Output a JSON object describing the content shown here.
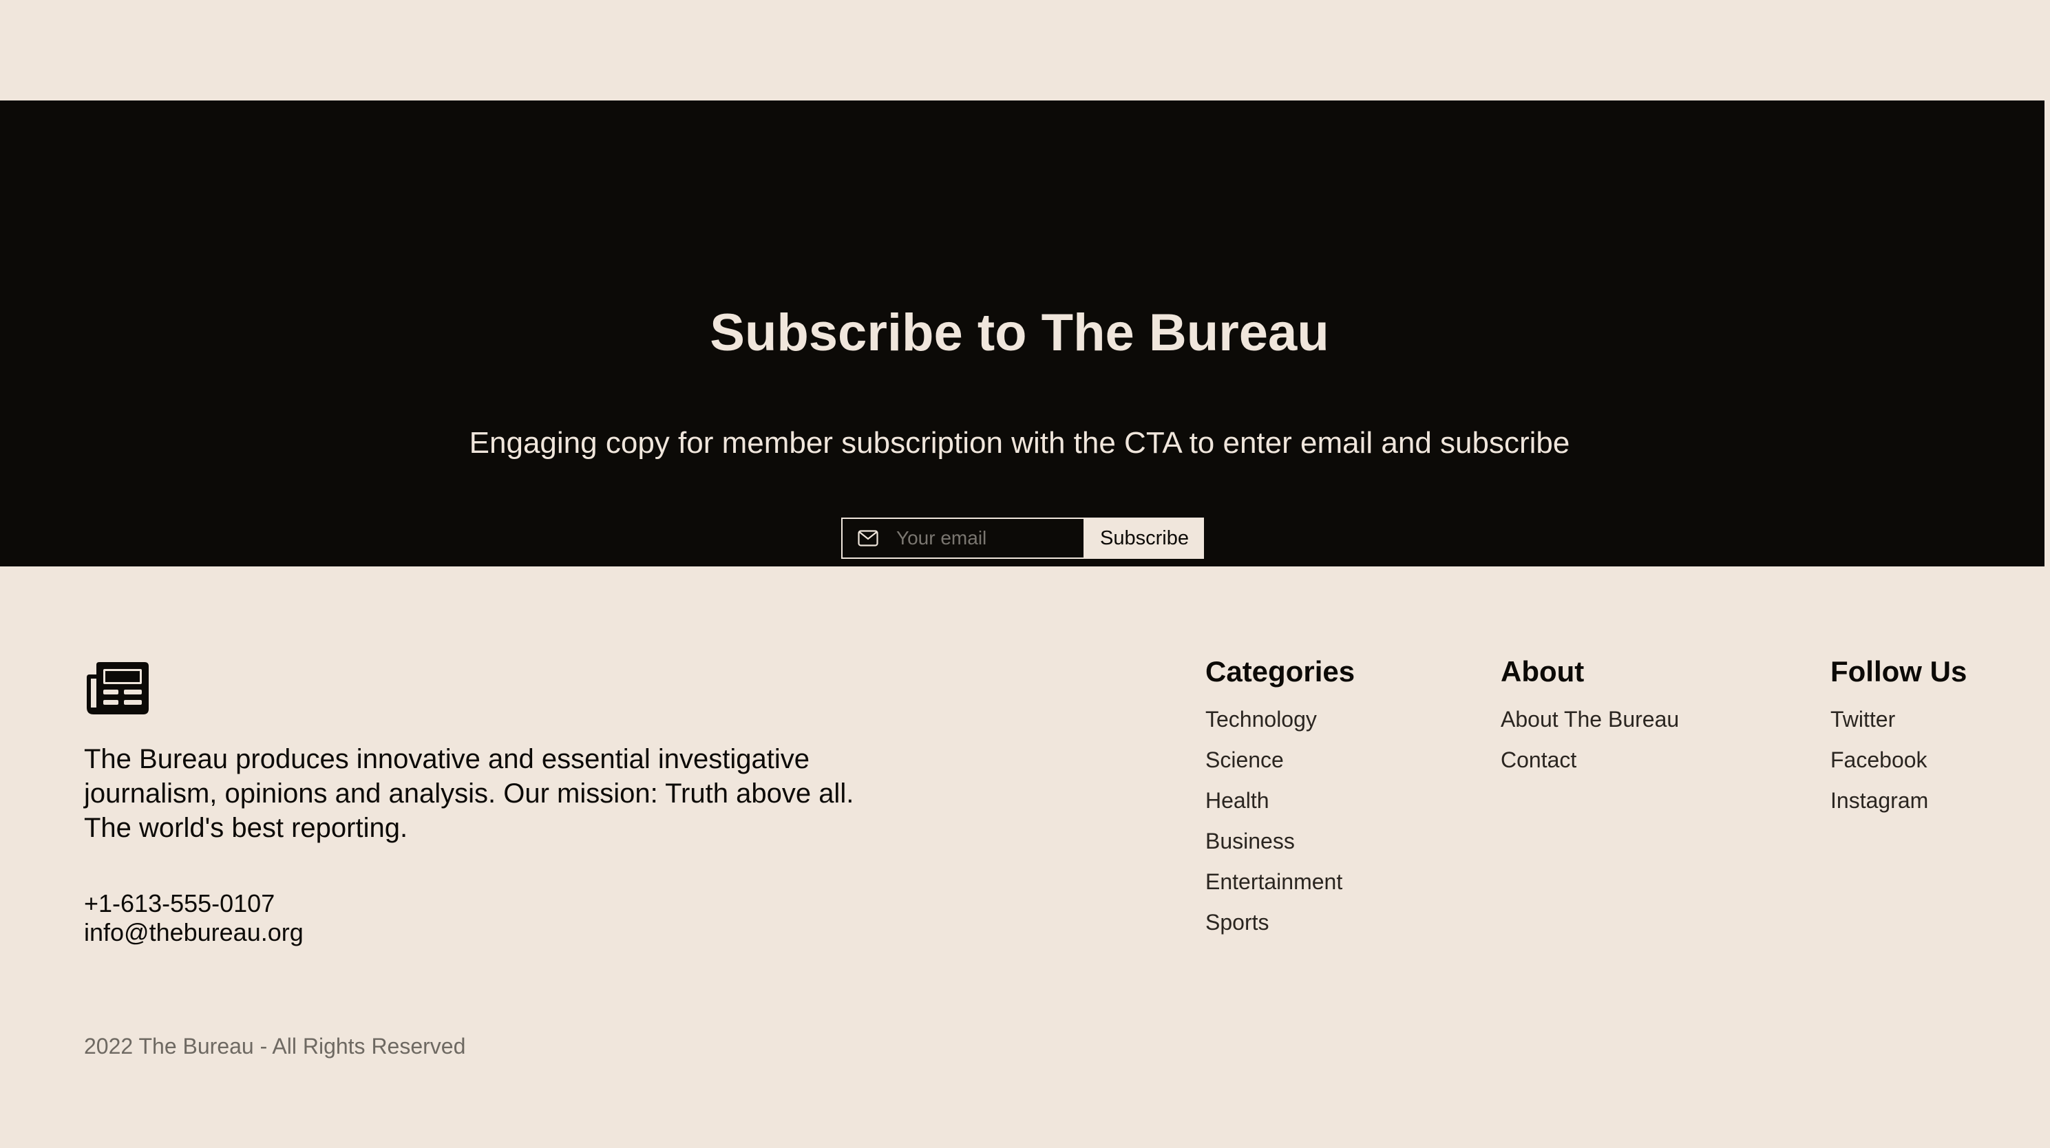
{
  "subscribe": {
    "title": "Subscribe to The Bureau",
    "copy": "Engaging copy for member subscription with the CTA to enter email and subscribe",
    "email_placeholder": "Your email",
    "button_label": "Subscribe"
  },
  "footer": {
    "logo_icon": "newspaper-icon",
    "mission": "The Bureau produces innovative and essential investigative journalism, opinions and analysis. Our mission: Truth above all. The world's best reporting.",
    "phone": "+1-613-555-0107",
    "email": "info@thebureau.org",
    "columns": [
      {
        "heading": "Categories",
        "links": [
          "Technology",
          "Science",
          "Health",
          "Business",
          "Entertainment",
          "Sports"
        ]
      },
      {
        "heading": "About",
        "links": [
          "About The Bureau",
          "Contact"
        ]
      },
      {
        "heading": "Follow Us",
        "links": [
          "Twitter",
          "Facebook",
          "Instagram"
        ]
      }
    ],
    "copyright": "2022 The Bureau - All Rights Reserved"
  },
  "colors": {
    "background": "#f0e6dc",
    "dark": "#0c0a07",
    "muted": "#6e6962"
  }
}
